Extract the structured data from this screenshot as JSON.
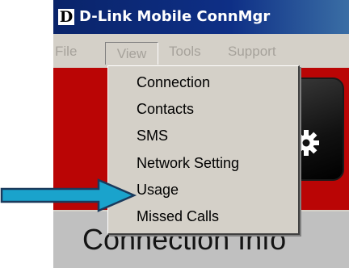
{
  "window": {
    "logo_letter": "D",
    "title": "D-Link Mobile ConnMgr"
  },
  "menubar": {
    "items": [
      "File",
      "View",
      "Tools",
      "Support"
    ]
  },
  "view_menu": {
    "items": [
      "Connection",
      "Contacts",
      "SMS",
      "Network Setting",
      "Usage",
      "Missed Calls"
    ]
  },
  "panel": {
    "label": "Connection Info"
  },
  "colors": {
    "titlebar": "#0a246a",
    "menu_bg": "#d4d0c8",
    "red": "#ba0505",
    "arrow_fill": "#1aa3cc",
    "arrow_stroke": "#1a3a5c"
  },
  "icons": {
    "pointer": "arrow-right-icon",
    "settings": "gear-icon"
  }
}
